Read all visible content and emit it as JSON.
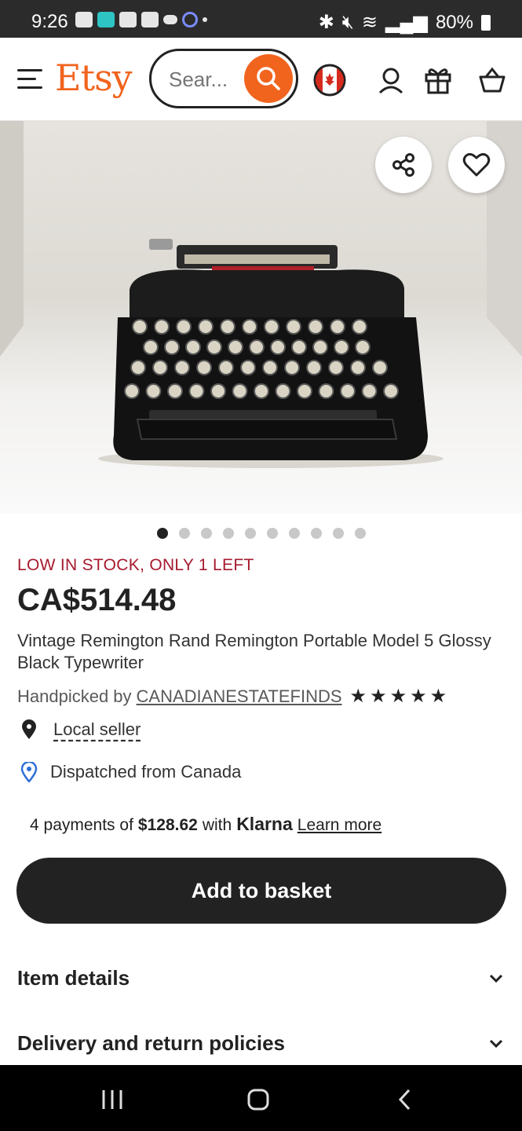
{
  "status_bar": {
    "time": "9:26",
    "battery": "80%"
  },
  "header": {
    "logo": "Etsy",
    "search_placeholder": "Sear..."
  },
  "product": {
    "image_count": 10,
    "active_image": 0,
    "stock_notice": "LOW IN STOCK, ONLY 1 LEFT",
    "price": "CA$514.48",
    "title": "Vintage Remington Rand Remington Portable Model 5 Glossy Black Typewriter",
    "seller_prefix": "Handpicked by",
    "seller_name": "CANADIANESTATEFINDS",
    "rating_stars": 5,
    "local_seller": "Local seller",
    "dispatch": "Dispatched from Canada"
  },
  "payments": {
    "prefix": "4 payments of",
    "amount": "$128.62",
    "with": "with",
    "provider": "Klarna",
    "learn_more": "Learn more"
  },
  "actions": {
    "add_to_basket": "Add to basket"
  },
  "sections": [
    {
      "label": "Item details"
    },
    {
      "label": "Delivery and return policies"
    }
  ],
  "colors": {
    "brand": "#f1641e",
    "stock": "#a61a2e",
    "button": "#222222"
  }
}
